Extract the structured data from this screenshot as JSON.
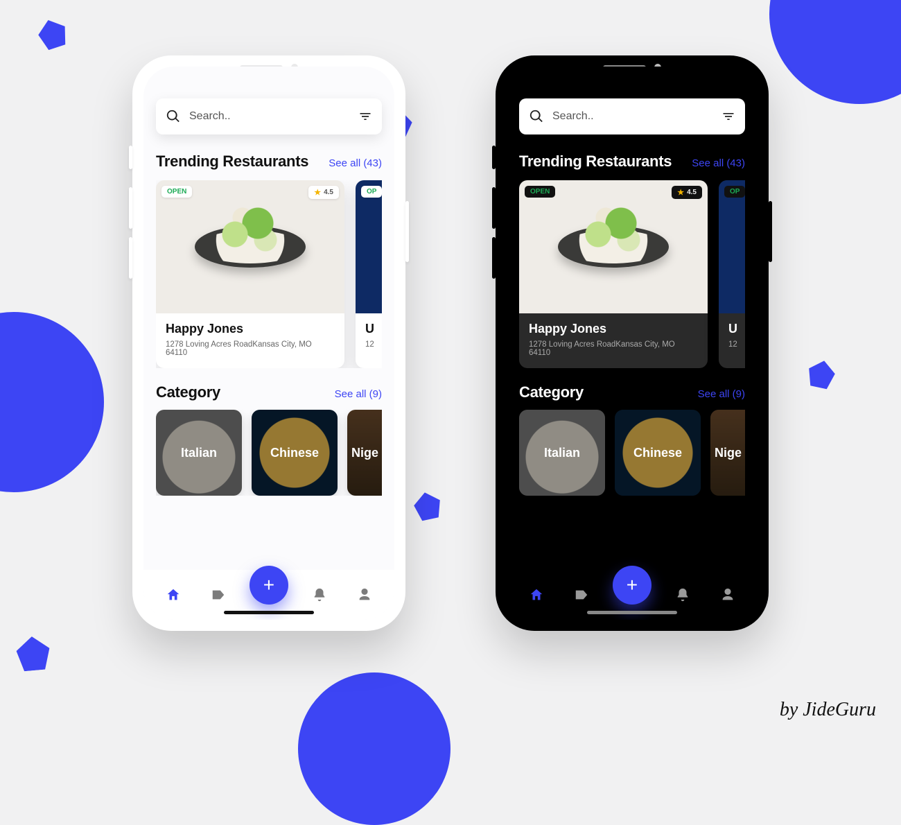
{
  "credit": "by JideGuru",
  "accent": "#3d45f4",
  "search": {
    "placeholder": "Search.."
  },
  "trending": {
    "title": "Trending Restaurants",
    "see_all": "See all (43)",
    "cards": [
      {
        "status": "OPEN",
        "rating": "4.5",
        "name": "Happy Jones",
        "address": "1278 Loving Acres RoadKansas City, MO 64110"
      },
      {
        "status": "OP",
        "rating": "",
        "name": "U",
        "address": "12"
      }
    ]
  },
  "category": {
    "title": "Category",
    "see_all": "See all (9)",
    "items": [
      {
        "label": "Italian"
      },
      {
        "label": "Chinese"
      },
      {
        "label": "Nige"
      }
    ]
  },
  "nav": {
    "items": [
      {
        "name": "home",
        "active": true
      },
      {
        "name": "label",
        "active": false
      },
      {
        "name": "fab-add"
      },
      {
        "name": "bell",
        "active": false
      },
      {
        "name": "user",
        "active": false
      }
    ],
    "fab_glyph": "+"
  }
}
